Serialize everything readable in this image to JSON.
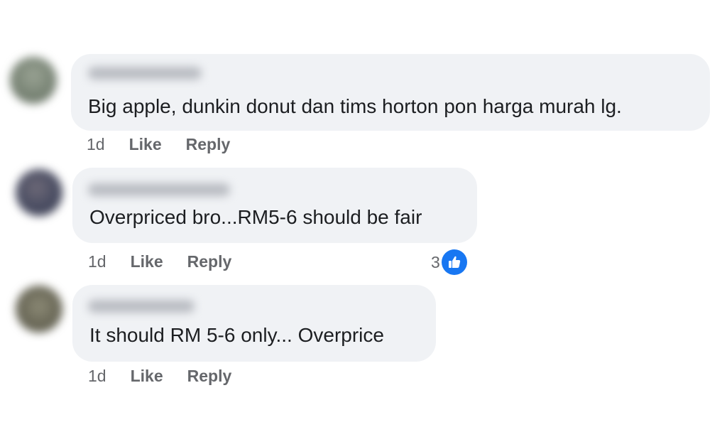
{
  "comments": [
    {
      "text": "Big apple, dunkin donut dan tims horton pon harga murah lg.",
      "time": "1d",
      "like_label": "Like",
      "reply_label": "Reply",
      "avatar_color": "#7f8a7b"
    },
    {
      "text": "Overpriced bro...RM5-6 should be fair",
      "time": "1d",
      "like_label": "Like",
      "reply_label": "Reply",
      "reaction_count": "3",
      "reaction_icon": "like-thumbs-up-icon",
      "avatar_color": "#4b4e63"
    },
    {
      "text": "It should RM 5-6 only... Overprice",
      "time": "1d",
      "like_label": "Like",
      "reply_label": "Reply",
      "avatar_color": "#6d6b5a"
    }
  ],
  "colors": {
    "bubble_bg": "#f0f2f5",
    "meta_text": "#65676b",
    "like_blue": "#1877f2"
  }
}
